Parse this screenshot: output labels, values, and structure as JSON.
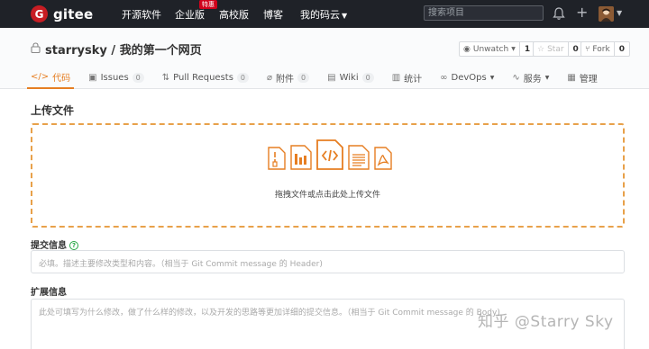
{
  "topnav": {
    "logo_mark": "G",
    "logo_text": "gitee",
    "links": {
      "opensource": "开源软件",
      "enterprise": "企业版",
      "enterprise_badge": "特惠",
      "university": "高校版",
      "blog": "博客",
      "mygitee": "我的码云"
    },
    "search_placeholder": "搜索项目"
  },
  "repo": {
    "owner": "starrysky",
    "separator": " / ",
    "name": "我的第一个网页",
    "watch": {
      "label": "Unwatch",
      "count": "1"
    },
    "star": {
      "label": "Star",
      "count": "0"
    },
    "fork": {
      "label": "Fork",
      "count": "0"
    }
  },
  "tabs": {
    "code": {
      "label": "代码"
    },
    "issues": {
      "label": "Issues",
      "count": "0"
    },
    "pulls": {
      "label": "Pull Requests",
      "count": "0"
    },
    "attachments": {
      "label": "附件",
      "count": "0"
    },
    "wiki": {
      "label": "Wiki",
      "count": "0"
    },
    "stats": {
      "label": "统计"
    },
    "devops": {
      "label": "DevOps"
    },
    "services": {
      "label": "服务"
    },
    "manage": {
      "label": "管理"
    }
  },
  "upload": {
    "title": "上传文件",
    "drop_hint": "拖拽文件或点击此处上传文件"
  },
  "commit": {
    "label": "提交信息",
    "help_icon": "?",
    "placeholder": "必填。描述主要修改类型和内容。（相当于 Git Commit message 的 Header)"
  },
  "extended": {
    "label": "扩展信息",
    "placeholder": "此处可填写为什么修改，做了什么样的修改，以及开发的思路等更加详细的提交信息。（相当于 Git Commit message 的 Body)"
  },
  "watermark": "知乎 @Starry Sky",
  "colors": {
    "nav_bg": "#1f2228",
    "brand_red": "#c71d23",
    "accent_orange": "#e67e22",
    "dashed_border": "#e8a14a"
  }
}
